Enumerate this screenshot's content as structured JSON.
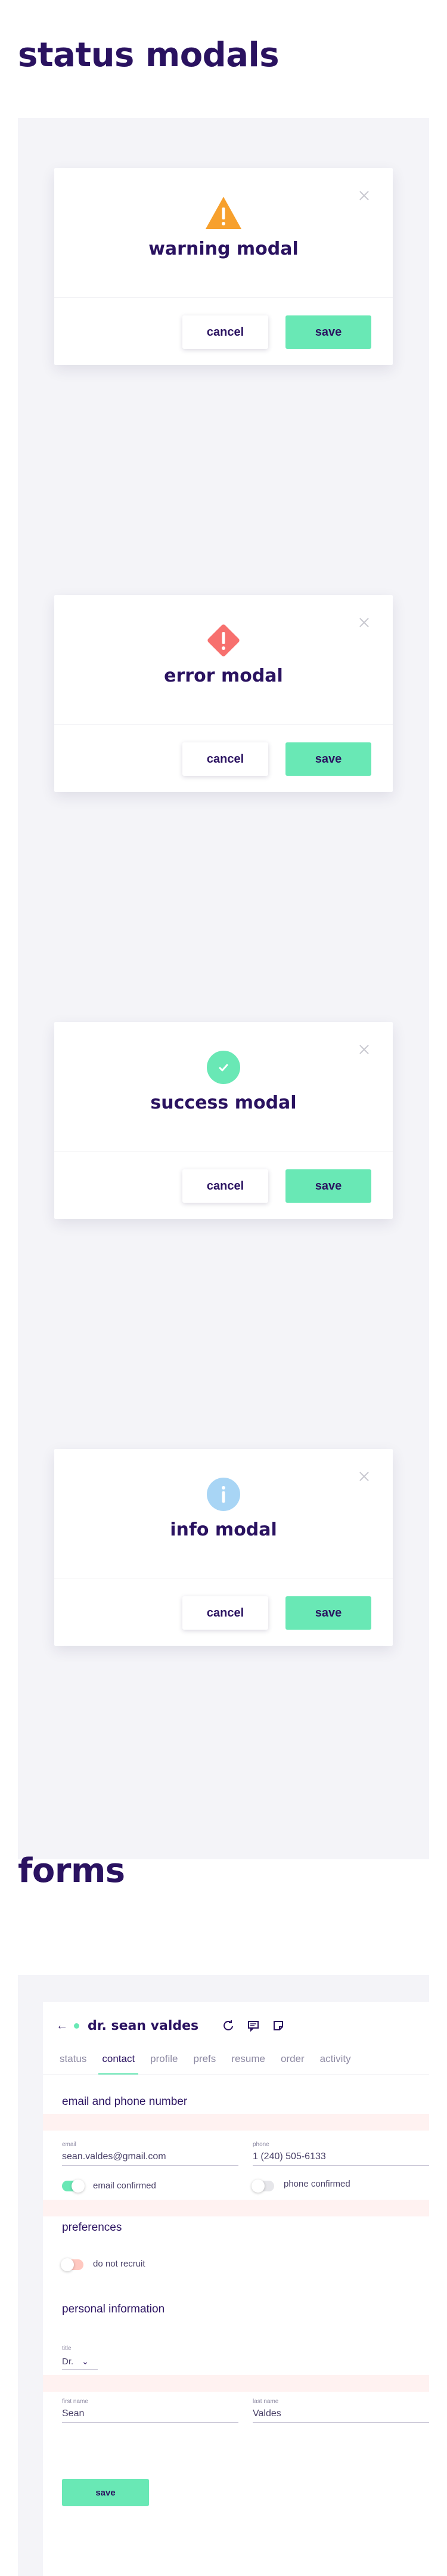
{
  "sections": {
    "status_title": "status modals",
    "forms_title": "forms"
  },
  "modals": [
    {
      "title": "warning modal",
      "cancel": "cancel",
      "save": "save",
      "icon": "warning-icon",
      "color": "#f7a02d"
    },
    {
      "title": "error modal",
      "cancel": "cancel",
      "save": "save",
      "icon": "error-icon",
      "color": "#f7706e"
    },
    {
      "title": "success modal",
      "cancel": "cancel",
      "save": "save",
      "icon": "check-icon",
      "color": "#69e8b5"
    },
    {
      "title": "info modal",
      "cancel": "cancel",
      "save": "save",
      "icon": "info-icon",
      "color": "#a8d5f5"
    }
  ],
  "form": {
    "name": "dr. sean valdes",
    "tabs": [
      "status",
      "contact",
      "profile",
      "prefs",
      "resume",
      "order",
      "activity"
    ],
    "active_tab": "contact",
    "email_section": "email and phone number",
    "email_label": "email",
    "email_value": "sean.valdes@gmail.com",
    "phone_label": "phone",
    "phone_value": "1 (240) 505-6133",
    "email_confirmed_label": "email confirmed",
    "email_confirmed": true,
    "phone_confirmed_label": "phone confirmed",
    "phone_confirmed": false,
    "preferences_section": "preferences",
    "do_not_recruit_label": "do not recruit",
    "do_not_recruit": false,
    "personal_section": "personal information",
    "title_label": "title",
    "title_value": "Dr.",
    "first_name_label": "first name",
    "first_name_value": "Sean",
    "last_name_label": "last name",
    "last_name_value": "Valdes",
    "save_label": "save"
  },
  "colors": {
    "accent": "#69e8b5",
    "heading": "#2a1260",
    "warning": "#f7a02d",
    "error": "#f7706e",
    "info": "#a8d5f5"
  }
}
